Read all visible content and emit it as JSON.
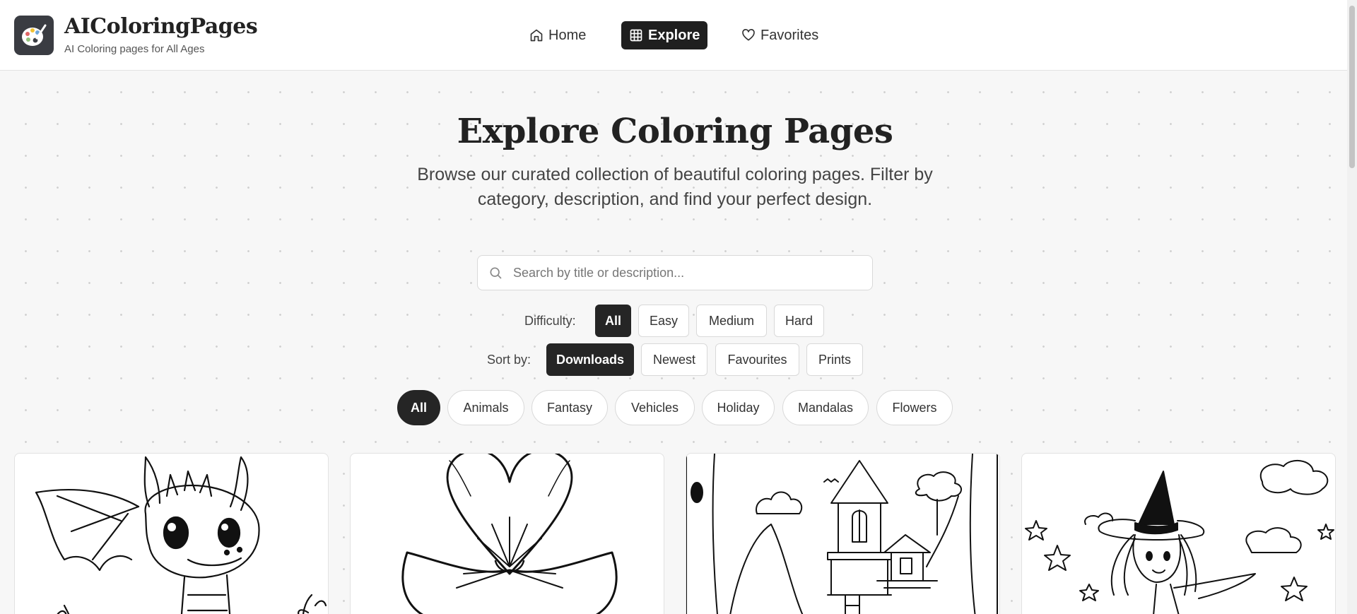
{
  "brand": {
    "title": "AIColoringPages",
    "subtitle": "AI Coloring pages for All Ages",
    "logo_icon": "palette-icon"
  },
  "nav": {
    "home": "Home",
    "explore": "Explore",
    "favorites": "Favorites",
    "active": "explore"
  },
  "hero": {
    "title": "Explore Coloring Pages",
    "description": "Browse our curated collection of beautiful coloring pages. Filter by category, description, and find your perfect design."
  },
  "search": {
    "placeholder": "Search by title or description...",
    "value": ""
  },
  "difficulty": {
    "label": "Difficulty:",
    "options": [
      "All",
      "Easy",
      "Medium",
      "Hard"
    ],
    "selected": "All"
  },
  "sort": {
    "label": "Sort by:",
    "options": [
      "Downloads",
      "Newest",
      "Favourites",
      "Prints"
    ],
    "selected": "Downloads"
  },
  "categories": {
    "options": [
      "All",
      "Animals",
      "Fantasy",
      "Vehicles",
      "Holiday",
      "Mandalas",
      "Flowers"
    ],
    "selected": "All"
  },
  "cards": [
    {
      "subject": "baby-dragon"
    },
    {
      "subject": "flower"
    },
    {
      "subject": "treehouse"
    },
    {
      "subject": "little-witch"
    }
  ],
  "colors": {
    "active_bg": "#252525",
    "header_bg": "#ffffff",
    "page_bg": "#f7f7f7"
  }
}
